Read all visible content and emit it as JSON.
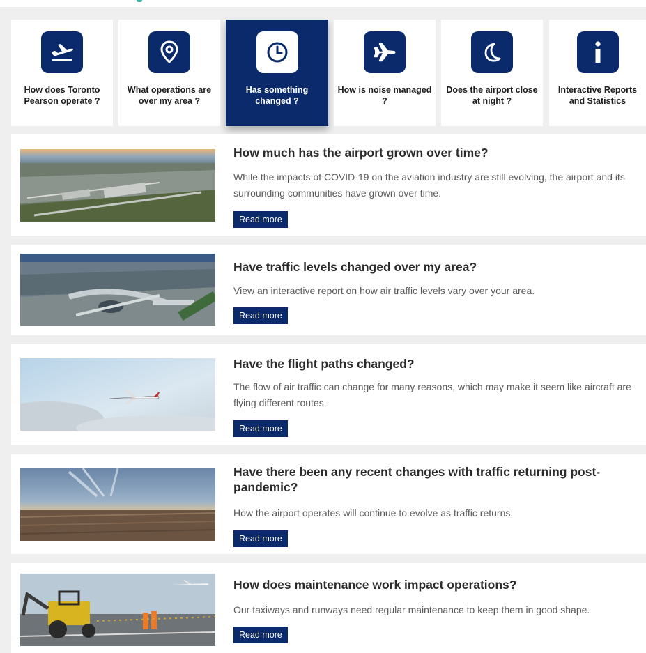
{
  "colors": {
    "brand_navy": "#0a2a6b",
    "background": "#efefef",
    "card": "#ffffff",
    "text_dark": "#2b2b2b",
    "text_muted": "#5a5a5a"
  },
  "nav": {
    "tiles": [
      {
        "label": "How does Toronto Pearson operate ?",
        "icon": "airplane-takeoff-icon",
        "active": false
      },
      {
        "label": "What operations are over my area ?",
        "icon": "map-pin-icon",
        "active": false
      },
      {
        "label": "Has something changed ?",
        "icon": "clock-icon",
        "active": true
      },
      {
        "label": "How is noise managed ?",
        "icon": "airplane-icon",
        "active": false
      },
      {
        "label": "Does the airport close at night ?",
        "icon": "moon-icon",
        "active": false
      },
      {
        "label": "Interactive Reports and Statistics",
        "icon": "info-icon",
        "active": false
      }
    ]
  },
  "articles": [
    {
      "title": "How much has the airport grown over time?",
      "description": "While the impacts of COVID-19 on the aviation industry are still evolving, the airport and its surrounding communities have grown over time.",
      "button": "Read more",
      "image": "aerial-airport-sunset-photo"
    },
    {
      "title": "Have traffic levels changed over my area?",
      "description": "View an interactive report on how air traffic levels vary over your area.",
      "button": "Read more",
      "image": "aerial-terminal-photo"
    },
    {
      "title": "Have the flight paths changed?",
      "description": "The flow of air traffic can change for many reasons, which may make it seem like aircraft are flying different routes.",
      "button": "Read more",
      "image": "airplane-in-sky-photo"
    },
    {
      "title": "Have there been any recent changes with traffic returning post-pandemic?",
      "description": "How the airport operates will continue to evolve as traffic returns.",
      "button": "Read more",
      "image": "aerial-neighbourhood-contrails-photo"
    },
    {
      "title": "How does maintenance work impact operations?",
      "description": "Our taxiways and runways need regular maintenance to keep them in good shape.",
      "button": "Read more",
      "image": "runway-maintenance-photo"
    }
  ]
}
